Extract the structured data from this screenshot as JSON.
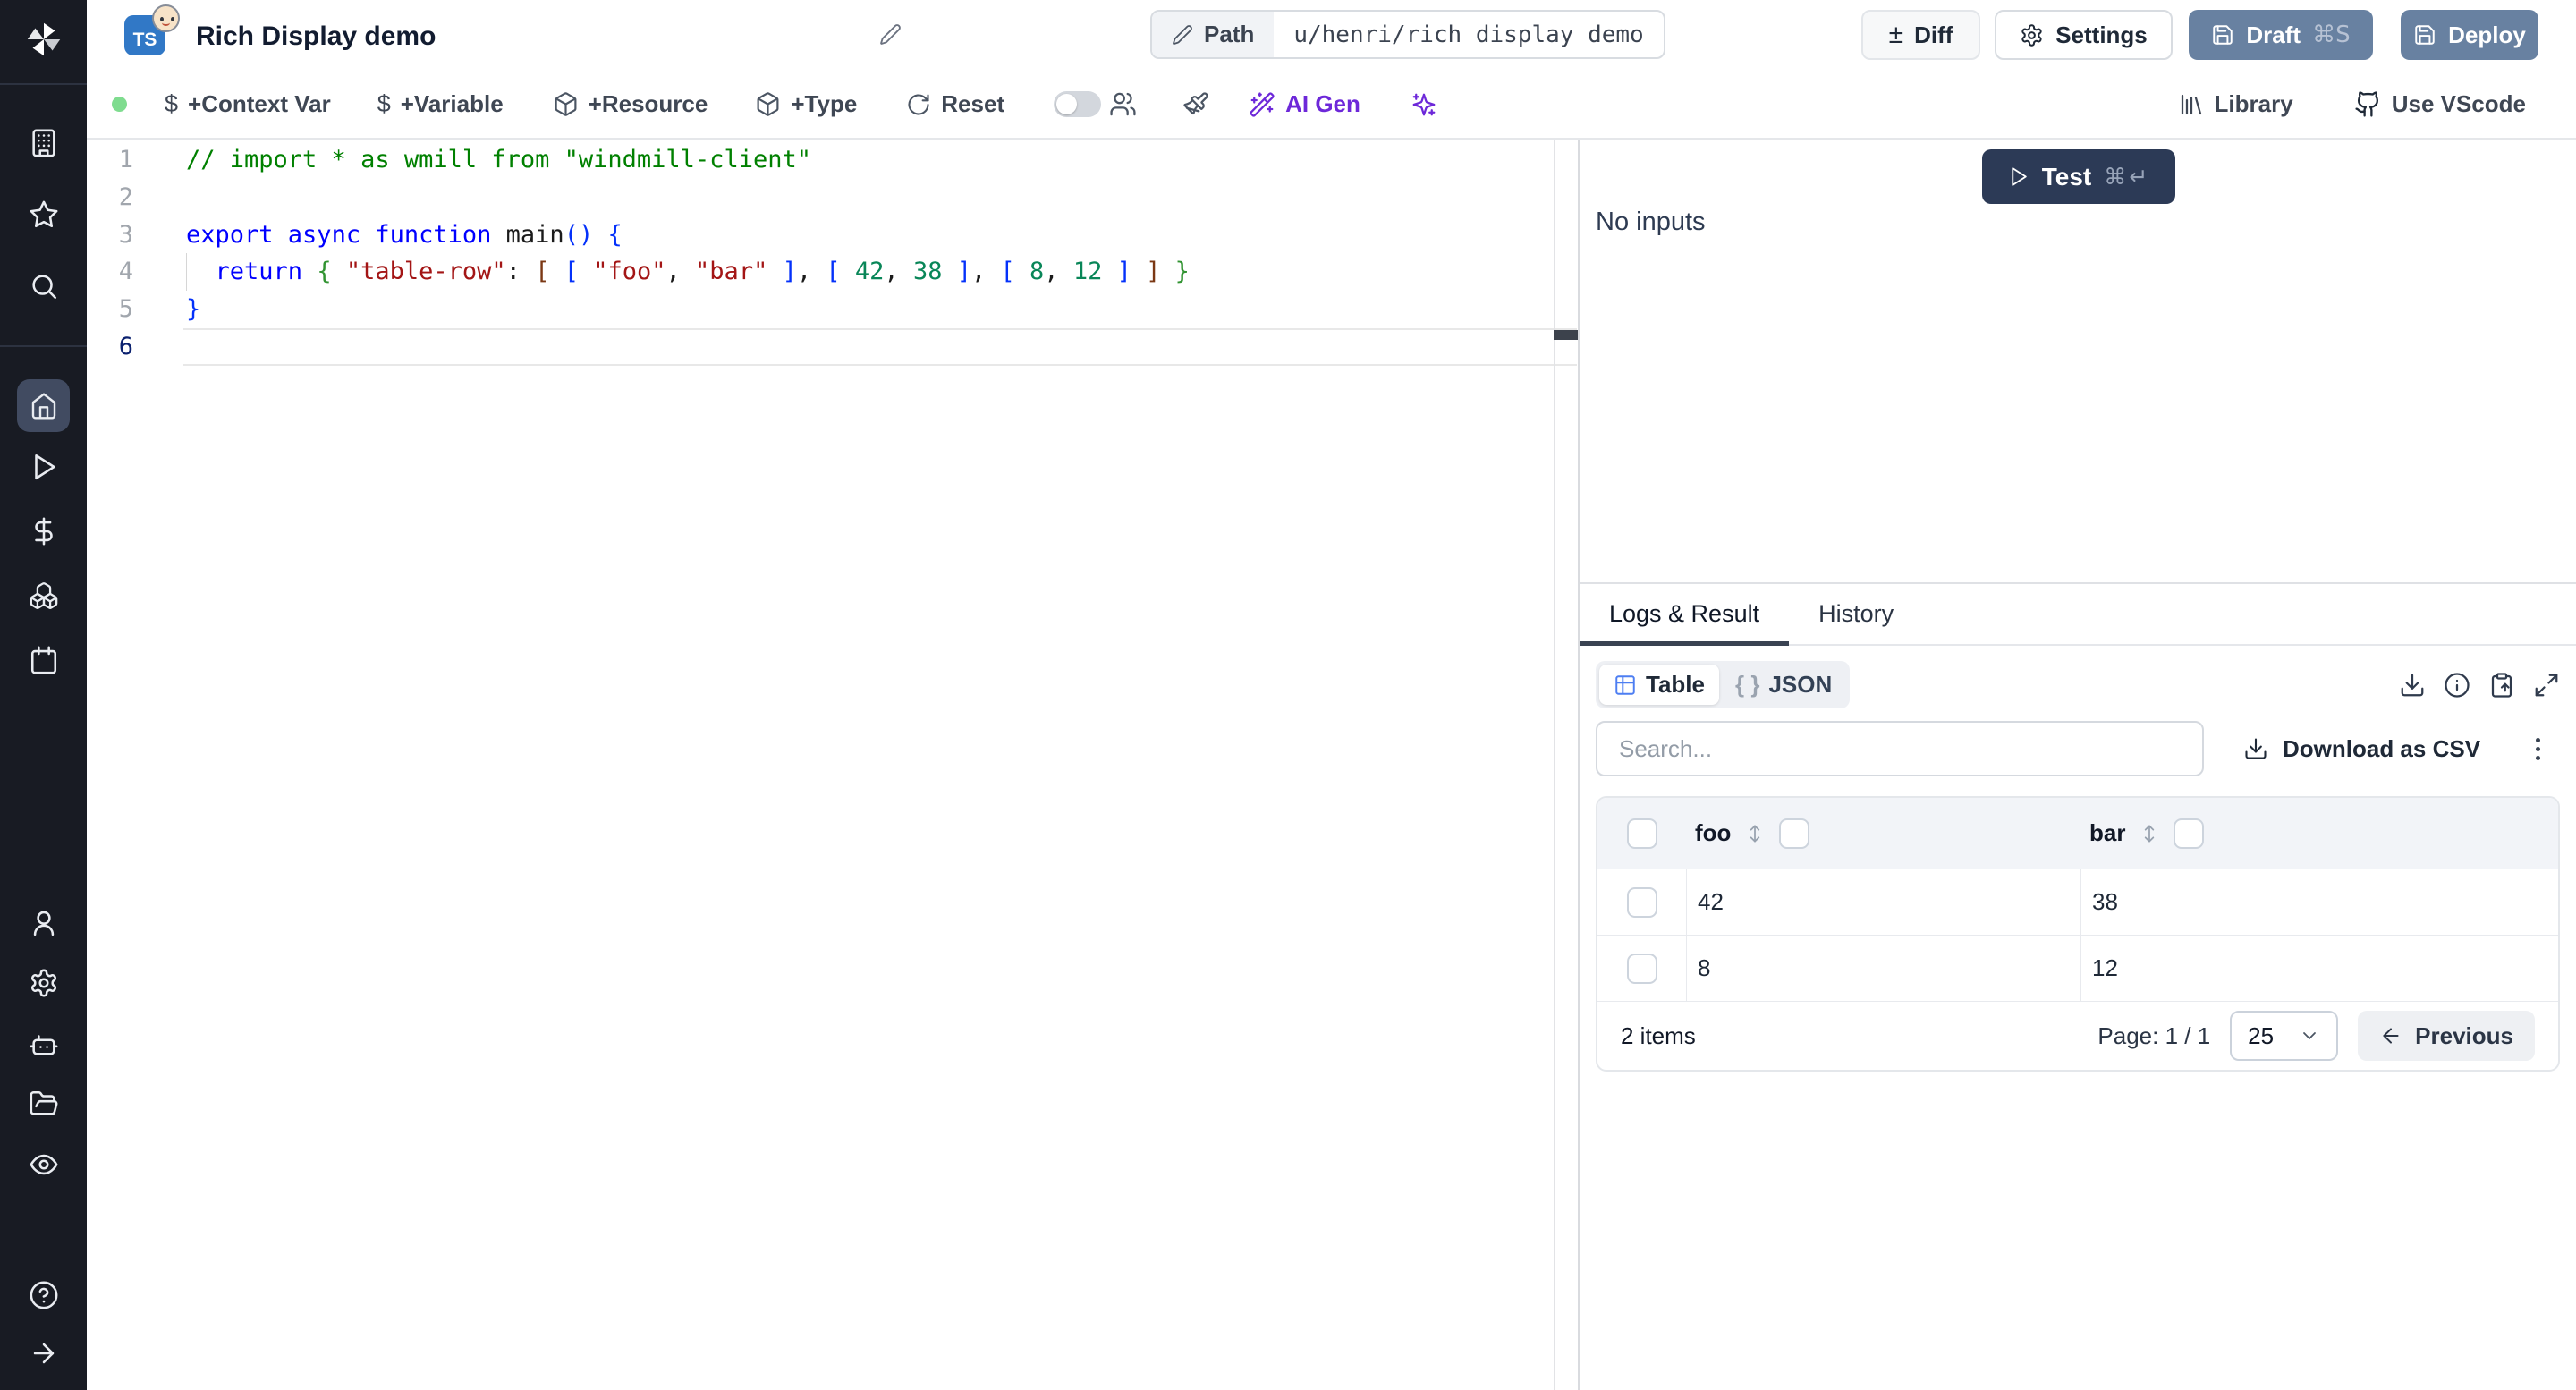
{
  "header": {
    "lang_badge": "TS",
    "title": "Rich Display demo",
    "path_label": "Path",
    "path_value": "u/henri/rich_display_demo",
    "diff_label": "Diff",
    "settings_label": "Settings",
    "draft_label": "Draft",
    "draft_shortcut": "⌘S",
    "deploy_label": "Deploy"
  },
  "toolbar": {
    "context_var_label": "+Context Var",
    "variable_label": "+Variable",
    "resource_label": "+Resource",
    "type_label": "+Type",
    "reset_label": "Reset",
    "ai_gen_label": "AI Gen",
    "library_label": "Library",
    "vscode_label": "Use VScode"
  },
  "editor": {
    "line_numbers": [
      "1",
      "2",
      "3",
      "4",
      "5",
      "6"
    ],
    "active_line": 6,
    "lines": [
      [
        {
          "t": "// import * as wmill from \"windmill-client\"",
          "c": "comment"
        }
      ],
      [],
      [
        {
          "t": "export ",
          "c": "keyword"
        },
        {
          "t": "async ",
          "c": "keyword"
        },
        {
          "t": "function ",
          "c": "keyword"
        },
        {
          "t": "main",
          "c": "plain"
        },
        {
          "t": "()",
          "c": "b1"
        },
        {
          "t": " ",
          "c": "plain"
        },
        {
          "t": "{",
          "c": "b1"
        }
      ],
      [
        {
          "t": "  ",
          "c": "plain"
        },
        {
          "t": "return",
          "c": "keyword"
        },
        {
          "t": " ",
          "c": "plain"
        },
        {
          "t": "{",
          "c": "b2"
        },
        {
          "t": " ",
          "c": "plain"
        },
        {
          "t": "\"table-row\"",
          "c": "string"
        },
        {
          "t": ": ",
          "c": "plain"
        },
        {
          "t": "[",
          "c": "b3"
        },
        {
          "t": " ",
          "c": "plain"
        },
        {
          "t": "[",
          "c": "b1"
        },
        {
          "t": " ",
          "c": "plain"
        },
        {
          "t": "\"foo\"",
          "c": "string"
        },
        {
          "t": ", ",
          "c": "plain"
        },
        {
          "t": "\"bar\"",
          "c": "string"
        },
        {
          "t": " ",
          "c": "plain"
        },
        {
          "t": "]",
          "c": "b1"
        },
        {
          "t": ", ",
          "c": "plain"
        },
        {
          "t": "[",
          "c": "b1"
        },
        {
          "t": " ",
          "c": "plain"
        },
        {
          "t": "42",
          "c": "number"
        },
        {
          "t": ", ",
          "c": "plain"
        },
        {
          "t": "38",
          "c": "number"
        },
        {
          "t": " ",
          "c": "plain"
        },
        {
          "t": "]",
          "c": "b1"
        },
        {
          "t": ", ",
          "c": "plain"
        },
        {
          "t": "[",
          "c": "b1"
        },
        {
          "t": " ",
          "c": "plain"
        },
        {
          "t": "8",
          "c": "number"
        },
        {
          "t": ", ",
          "c": "plain"
        },
        {
          "t": "12",
          "c": "number"
        },
        {
          "t": " ",
          "c": "plain"
        },
        {
          "t": "]",
          "c": "b1"
        },
        {
          "t": " ",
          "c": "plain"
        },
        {
          "t": "]",
          "c": "b3"
        },
        {
          "t": " ",
          "c": "plain"
        },
        {
          "t": "}",
          "c": "b2"
        }
      ],
      [
        {
          "t": "}",
          "c": "b1"
        }
      ],
      []
    ]
  },
  "run_panel": {
    "test_label": "Test",
    "test_shortcut": "⌘↵",
    "empty_text": "No inputs"
  },
  "result_panel": {
    "tabs": [
      {
        "label": "Logs & Result",
        "active": true
      },
      {
        "label": "History",
        "active": false
      }
    ],
    "view_modes": [
      {
        "label": "Table",
        "active": true
      },
      {
        "label": "JSON",
        "active": false
      }
    ],
    "search_placeholder": "Search...",
    "download_csv_label": "Download as CSV",
    "table": {
      "columns": [
        "foo",
        "bar"
      ],
      "rows": [
        [
          "42",
          "38"
        ],
        [
          "8",
          "12"
        ]
      ],
      "items_label": "2 items",
      "page_label": "Page: 1 / 1",
      "page_size": "25",
      "previous_label": "Previous"
    }
  },
  "colors": {
    "ts_badge_blue": "#3178c6",
    "ai_purple": "#6d28d9",
    "status_green": "#7fdc8f",
    "primary_button_slate": "#6881a1",
    "test_button_navy": "#2c3a56",
    "sidebar_dark": "#181b23"
  },
  "icons": {
    "sidebar": [
      "windmill-logo",
      "building",
      "star",
      "search",
      "home",
      "play",
      "dollar",
      "boxes",
      "calendar",
      "user",
      "gear",
      "robot",
      "folder-open",
      "eye",
      "help-circle",
      "arrow-right"
    ],
    "misc": [
      "pencil",
      "plus-minus",
      "gear",
      "save",
      "package",
      "rotate-cw",
      "users",
      "paintbrush",
      "wand-sparkles",
      "sparkles",
      "library",
      "github-cat",
      "play-outline",
      "download",
      "info",
      "clipboard-copy",
      "maximize",
      "kebab",
      "chevron-down",
      "arrow-left",
      "arrows-up-down",
      "table-grid",
      "braces"
    ]
  }
}
